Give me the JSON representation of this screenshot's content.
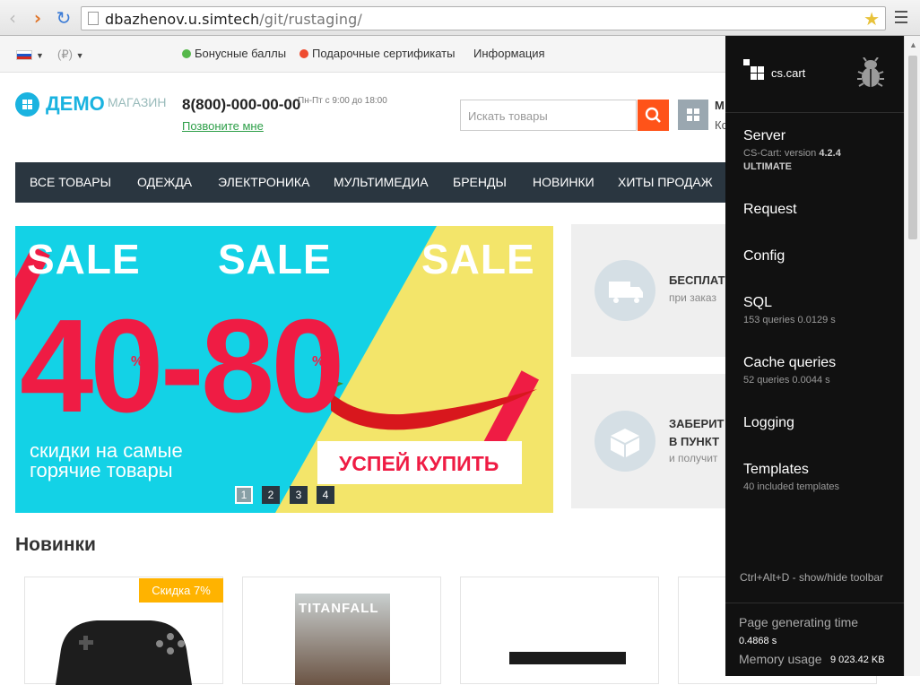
{
  "browser": {
    "url_host": "dbazhenov.u.simtech",
    "url_path": "/git/rustaging/"
  },
  "topbar": {
    "currency": "(₽)",
    "links": [
      "Бонусные баллы",
      "Подарочные сертификаты",
      "Информация"
    ]
  },
  "header": {
    "logo_main": "ДЕМО",
    "logo_sub": "МАГАЗИН",
    "phone": "8(800)-000-00-00",
    "hours": "Пн-Пт с 9:00 до 18:00",
    "callback": "Позвоните мне",
    "search_placeholder": "Искать товары",
    "cart_title": "М",
    "cart_sub": "Ко"
  },
  "nav": [
    "ВСЕ ТОВАРЫ",
    "ОДЕЖДА",
    "ЭЛЕКТРОНИКА",
    "МУЛЬТИМЕДИА",
    "БРЕНДЫ",
    "НОВИНКИ",
    "ХИТЫ ПРОДАЖ"
  ],
  "banner": {
    "sale_word": "SALE",
    "big_text": "40-80",
    "percent_sign": "%",
    "promo_line1": "скидки на самые",
    "promo_line2": "горячие товары",
    "cta": "УСПЕЙ КУПИТЬ",
    "pages": [
      "1",
      "2",
      "3",
      "4"
    ],
    "ribbon_text": "SALE SALE SALE"
  },
  "side": {
    "box1_title": "БЕСПЛАТ",
    "box1_sub": "при заказ",
    "box2_title_1": "ЗАБЕРИТ",
    "box2_title_2": "В ПУНКТ",
    "box2_sub": "и получит"
  },
  "products": {
    "title": "Новинки",
    "discount": "Скидка 7%",
    "game_title": "TITANFALL"
  },
  "debug": {
    "brand": "cs.cart",
    "items": [
      {
        "label": "Server",
        "sub_prefix": "CS-Cart: version ",
        "sub_version": "4.2.4",
        "sub_edition": "ULTIMATE"
      },
      {
        "label": "Request"
      },
      {
        "label": "Config"
      },
      {
        "label": "SQL",
        "sub": "153 queries 0.0129 s"
      },
      {
        "label": "Cache queries",
        "sub": "52 queries 0.0044 s"
      },
      {
        "label": "Logging"
      },
      {
        "label": "Templates",
        "sub": "40 included templates"
      }
    ],
    "hotkey": "Ctrl+Alt+D - show/hide toolbar",
    "gen_label": "Page generating time",
    "gen_value": "0.4868 s",
    "mem_label": "Memory usage",
    "mem_value": "9 023.42 KB"
  },
  "colors": {
    "accent": "#1ab3e0",
    "search_button": "#ff5319",
    "nav_bg": "#2a3640",
    "sale_red": "#ef1c44",
    "discount": "#ffb300",
    "debug_bg": "#111111"
  }
}
